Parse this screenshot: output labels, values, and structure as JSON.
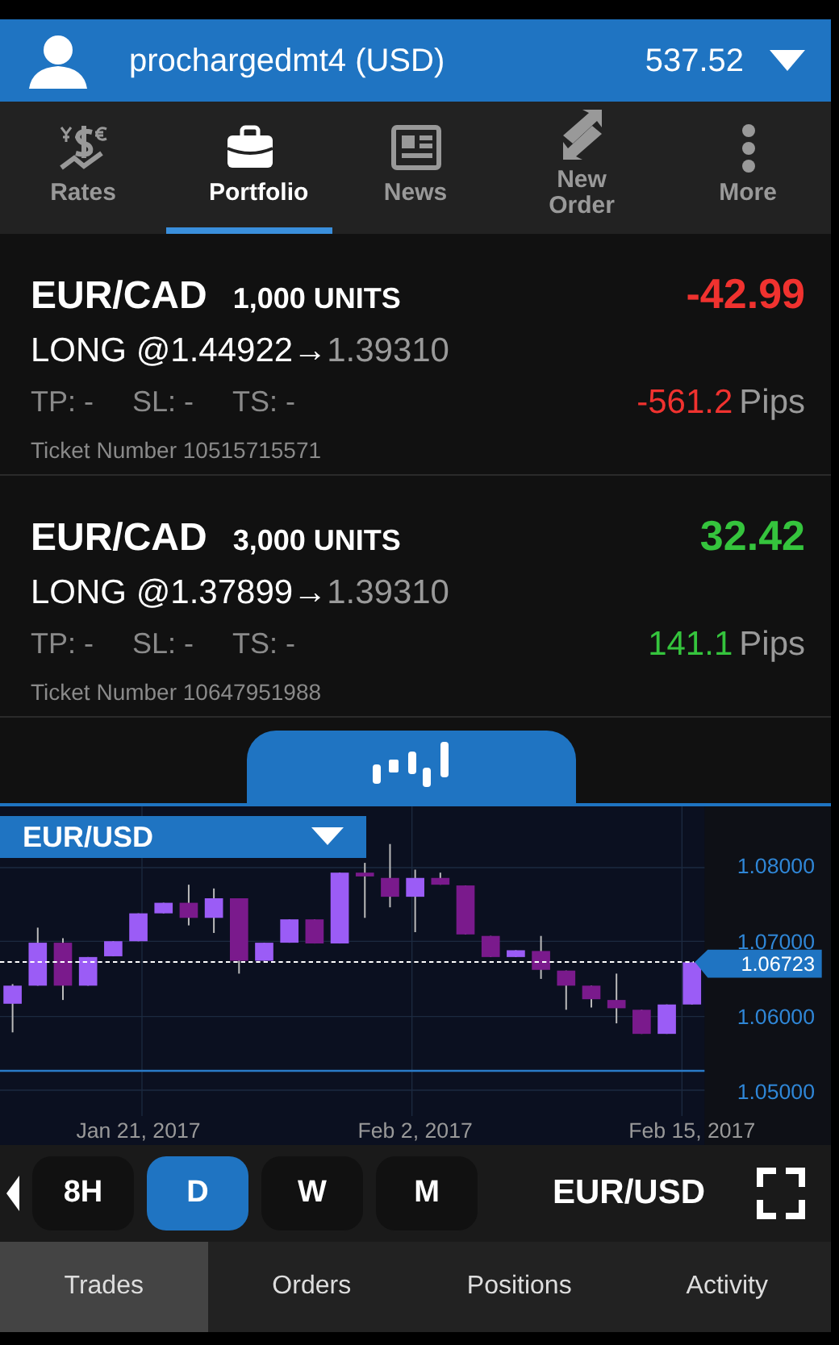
{
  "account": {
    "name": "prochargedmt4 (USD)",
    "balance": "537.52"
  },
  "nav": [
    {
      "label": "Rates",
      "kind": "rates",
      "selected": false
    },
    {
      "label": "Portfolio",
      "kind": "portfolio",
      "selected": true
    },
    {
      "label": "News",
      "kind": "news",
      "selected": false
    },
    {
      "label": "New Order",
      "kind": "order",
      "selected": false
    },
    {
      "label": "More",
      "kind": "more",
      "selected": false
    }
  ],
  "trades": [
    {
      "symbol": "EUR/CAD",
      "units": "1,000 UNITS",
      "pl": "-42.99",
      "entry": "LONG @1.44922→",
      "current": "1.39310",
      "tp": "TP: -",
      "sl": "SL: -",
      "ts": "TS: -",
      "ticket": "Ticket Number 10515715571",
      "pips": "-561.2",
      "pips_unit": "Pips",
      "color": "#f0322f"
    },
    {
      "symbol": "EUR/CAD",
      "units": "3,000 UNITS",
      "pl": "32.42",
      "entry": "LONG @1.37899→",
      "current": "1.39310",
      "tp": "TP: -",
      "sl": "SL: -",
      "ts": "TS: -",
      "ticket": "Ticket Number 10647951988",
      "pips": "141.1",
      "pips_unit": "Pips",
      "color": "#35c43d"
    }
  ],
  "chart": {
    "symbol": "EUR/USD",
    "chart_data": {
      "type": "candlestick",
      "categories": [
        null,
        null,
        null,
        null,
        null,
        "Jan 21, 2017",
        null,
        null,
        null,
        null,
        null,
        null,
        null,
        null,
        null,
        null,
        "Feb 2, 2017",
        null,
        null,
        null,
        null,
        null,
        null,
        null,
        null,
        null,
        null,
        "Feb 15, 2017"
      ],
      "ohlc": [
        [
          1.0617,
          1.0643,
          1.0579,
          1.0641
        ],
        [
          1.0641,
          1.0718,
          1.0641,
          1.0698
        ],
        [
          1.0698,
          1.0704,
          1.0622,
          1.0641
        ],
        [
          1.0641,
          1.0679,
          1.0641,
          1.0679
        ],
        [
          1.068,
          1.07,
          1.068,
          1.07
        ],
        [
          1.07,
          1.0737,
          1.07,
          1.0737
        ],
        [
          1.0737,
          1.0751,
          1.0737,
          1.0751
        ],
        [
          1.0751,
          1.0775,
          1.0721,
          1.0731
        ],
        [
          1.0731,
          1.077,
          1.0711,
          1.0757
        ],
        [
          1.0757,
          1.0757,
          1.0657,
          1.0674
        ],
        [
          1.0674,
          1.0698,
          1.0674,
          1.0698
        ],
        [
          1.0698,
          1.0729,
          1.0698,
          1.0729
        ],
        [
          1.0729,
          1.0729,
          1.0697,
          1.0697
        ],
        [
          1.0697,
          1.0791,
          1.0697,
          1.0791
        ],
        [
          1.0791,
          1.0804,
          1.0731,
          1.0786
        ],
        [
          1.0784,
          1.0829,
          1.0745,
          1.0759
        ],
        [
          1.0759,
          1.0795,
          1.0712,
          1.0784
        ],
        [
          1.0784,
          1.0791,
          1.0775,
          1.0775
        ],
        [
          1.0774,
          1.0774,
          1.0709,
          1.0709
        ],
        [
          1.0707,
          1.0707,
          1.0679,
          1.0679
        ],
        [
          1.0679,
          1.0688,
          1.0679,
          1.0688
        ],
        [
          1.0687,
          1.0707,
          1.065,
          1.0662
        ],
        [
          1.0661,
          1.0661,
          1.0609,
          1.0641
        ],
        [
          1.0641,
          1.0641,
          1.0612,
          1.0623
        ],
        [
          1.0622,
          1.0657,
          1.0591,
          1.0611
        ],
        [
          1.0609,
          1.0609,
          1.0577,
          1.0577
        ],
        [
          1.0577,
          1.0616,
          1.0577,
          1.0616
        ],
        [
          1.0616,
          1.0672,
          1.0616,
          1.0672
        ]
      ],
      "yticks": [
        {
          "value": 1.08,
          "label": "1.08000"
        },
        {
          "value": 1.07,
          "label": "1.07000"
        },
        {
          "value": 1.06,
          "label": "1.06000"
        },
        {
          "value": 1.05,
          "label": "1.05000"
        }
      ],
      "ylim": [
        1.0468,
        1.0879
      ],
      "grid": true,
      "ref_lines": [
        {
          "axis": "y",
          "value": 1.06723,
          "label": "1.06723"
        }
      ]
    }
  },
  "timeframes": [
    {
      "label": "8H",
      "selected": false
    },
    {
      "label": "D",
      "selected": true
    },
    {
      "label": "W",
      "selected": false
    },
    {
      "label": "M",
      "selected": false
    }
  ],
  "chart_symbol": "EUR/USD",
  "bottom_tabs": [
    {
      "label": "Trades",
      "selected": true
    },
    {
      "label": "Orders",
      "selected": false
    },
    {
      "label": "Positions",
      "selected": false
    },
    {
      "label": "Activity",
      "selected": false
    }
  ]
}
